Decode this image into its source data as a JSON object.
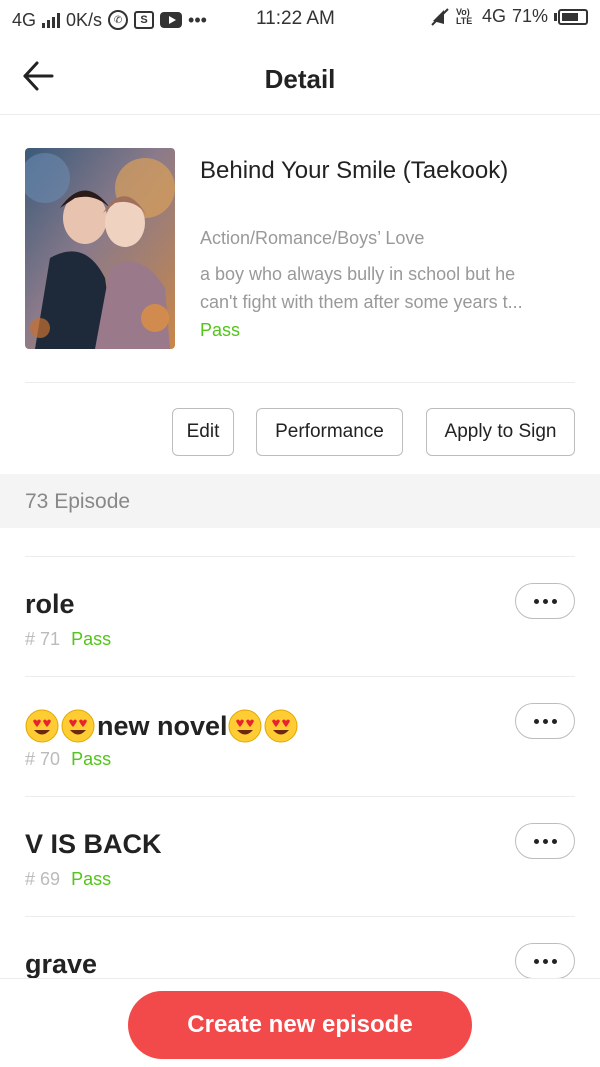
{
  "status_bar": {
    "network": "4G",
    "speed": "0K/s",
    "s_icon_letter": "S",
    "more": "•••",
    "time": "11:22 AM",
    "volte": "Vo) LTE",
    "network_right": "4G",
    "battery": "71%"
  },
  "header": {
    "title": "Detail",
    "back_icon": "arrow-left-icon"
  },
  "book": {
    "title": "Behind Your Smile (Taekook)",
    "genre": "Action/Romance/Boys’ Love",
    "desc_line1": "a boy who always bully in school but he",
    "desc_line2": "can't fight with them after some years t...",
    "status": "Pass"
  },
  "actions": {
    "edit": "Edit",
    "performance": "Performance",
    "apply": "Apply to Sign"
  },
  "episodes_header": "73 Episode",
  "episodes": [
    {
      "title": "role",
      "num": "# 71",
      "status": "Pass"
    },
    {
      "title": "new novel",
      "num": "# 70",
      "status": "Pass"
    },
    {
      "title": "V IS BACK",
      "num": "# 69",
      "status": "Pass"
    },
    {
      "title": "grave"
    }
  ],
  "create_button": "Create new episode",
  "colors": {
    "accent_red": "#f24a4a",
    "pass_green": "#52c41a"
  }
}
